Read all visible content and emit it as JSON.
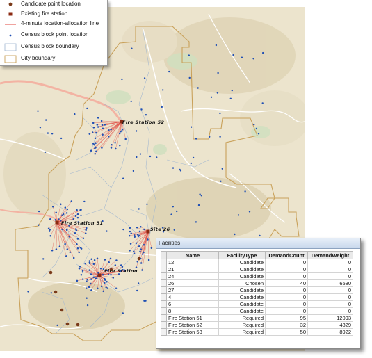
{
  "legend": {
    "items": [
      {
        "label": "Candidate point location",
        "icon": "candidate-point-icon"
      },
      {
        "label": "Existing fire station",
        "icon": "existing-station-icon"
      },
      {
        "label": "4-minute location-allocation line",
        "icon": "allocation-line-icon"
      },
      {
        "label": "Census block point location",
        "icon": "census-point-icon"
      },
      {
        "label": "Census block boundary",
        "icon": "census-boundary-icon"
      },
      {
        "label": "City boundary",
        "icon": "city-boundary-icon"
      }
    ]
  },
  "map": {
    "labels": {
      "fs52": "Fire Station 52",
      "fs51": "Fire Station 51",
      "site26": "Site 26",
      "fs53": "Fire Station"
    },
    "colors": {
      "terrain": "#ede5cf",
      "city_boundary": "#c9a15a",
      "allocation_line": "#e0473f",
      "census_point": "#1f4fb4",
      "existing_station": "#8b2a12",
      "candidate": "#7a3a1a"
    }
  },
  "facilities": {
    "title": "Facilities",
    "columns": [
      "Name",
      "FacilityType",
      "DemandCount",
      "DemandWeight"
    ],
    "rows": [
      [
        "12",
        "Candidate",
        "0",
        "0"
      ],
      [
        "21",
        "Candidate",
        "0",
        "0"
      ],
      [
        "24",
        "Candidate",
        "0",
        "0"
      ],
      [
        "26",
        "Chosen",
        "40",
        "6580"
      ],
      [
        "27",
        "Candidate",
        "0",
        "0"
      ],
      [
        "4",
        "Candidate",
        "0",
        "0"
      ],
      [
        "6",
        "Candidate",
        "0",
        "0"
      ],
      [
        "8",
        "Candidate",
        "0",
        "0"
      ],
      [
        "Fire Station 51",
        "Required",
        "95",
        "12093"
      ],
      [
        "Fire Station 52",
        "Required",
        "32",
        "4829"
      ],
      [
        "Fire Station 53",
        "Required",
        "50",
        "8922"
      ]
    ]
  }
}
